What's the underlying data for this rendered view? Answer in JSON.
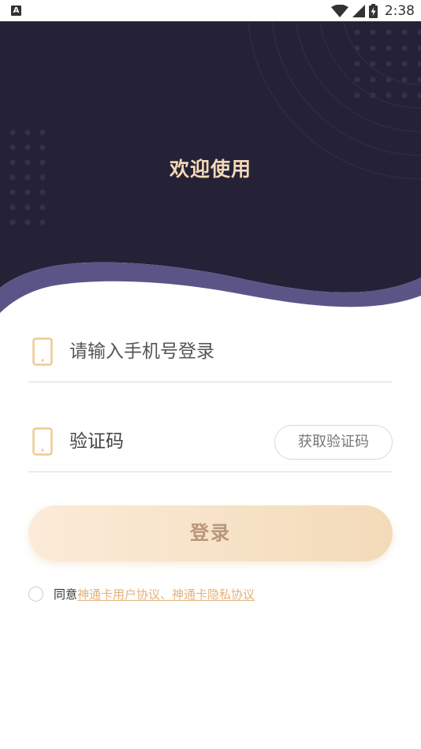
{
  "status_bar": {
    "left_icon": "A",
    "time": "2:38",
    "icons": [
      "wifi-icon",
      "cell-signal-icon",
      "battery-charging-icon"
    ]
  },
  "header": {
    "title": "欢迎使用",
    "colors": {
      "background": "#252238",
      "wave": "#5b5587",
      "title": "#f4d9b6"
    }
  },
  "login_form": {
    "phone": {
      "icon": "phone-icon",
      "placeholder": "请输入手机号登录"
    },
    "code": {
      "icon": "phone-icon",
      "placeholder": "验证码",
      "send_button": "获取验证码"
    },
    "submit_label": "登录"
  },
  "agreement": {
    "checked": false,
    "prefix": "同意",
    "link_text": "神通卡用户协议、神通卡隐私协议",
    "link_color": "#e2b27a"
  }
}
